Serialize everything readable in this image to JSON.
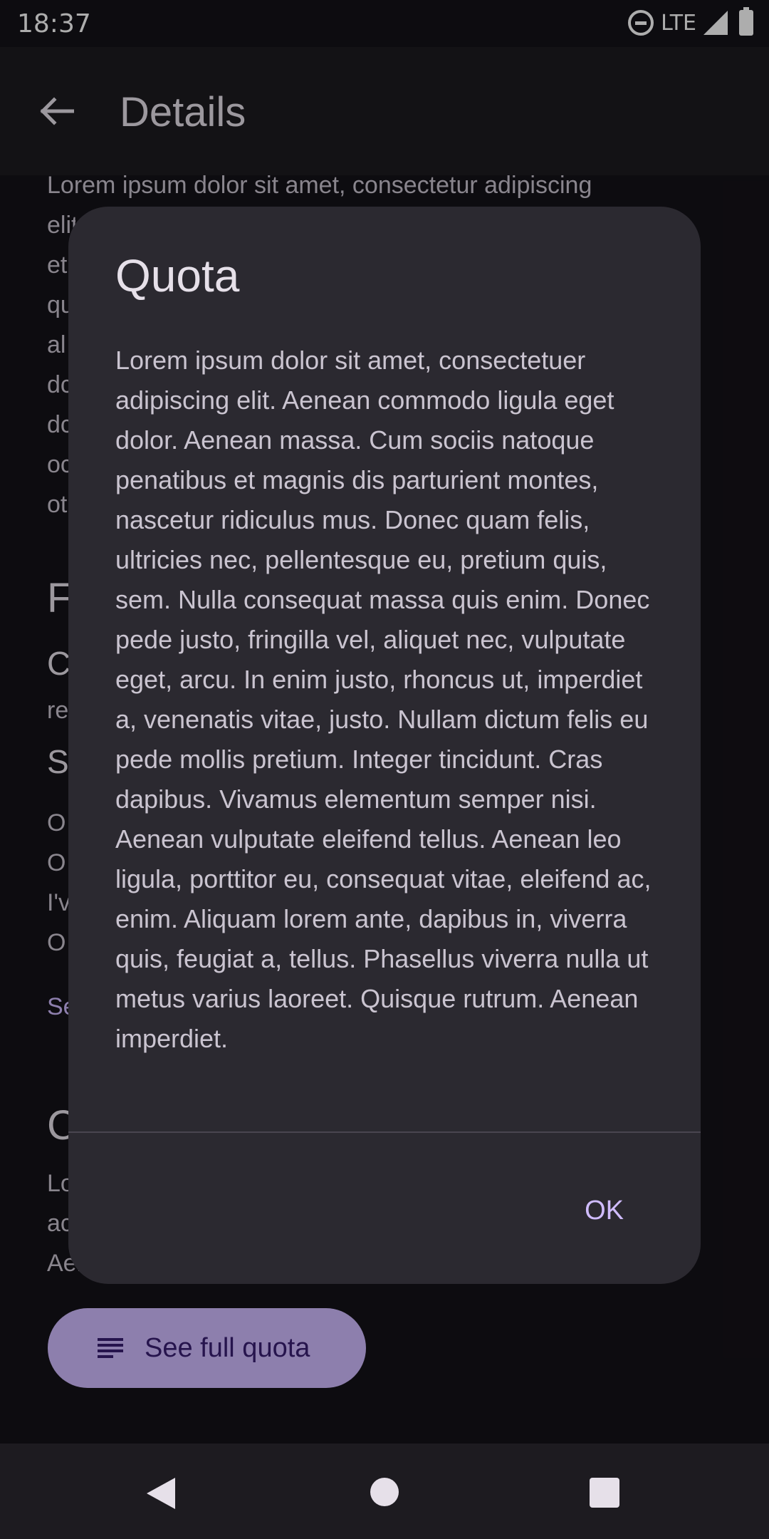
{
  "status_bar": {
    "time": "18:37",
    "network": "LTE"
  },
  "app_bar": {
    "title": "Details"
  },
  "background": {
    "paragraph": "Lorem ipsum dolor sit amet, consectetur adipiscing elit, et qu al dc dc oc ot",
    "heading_stub": "F",
    "sub_stub": "C",
    "small_stub": "re",
    "sub2_stub": "S",
    "lines": [
      "O",
      "O",
      "I'v",
      "O"
    ],
    "link_stub": "Se",
    "heading2_stub": "C",
    "para2_lines": [
      "Lo",
      "ac",
      "Aen"
    ]
  },
  "fab": {
    "label": "See full quota",
    "icon": "notes-icon"
  },
  "dialog": {
    "title": "Quota",
    "body": "Lorem ipsum dolor sit amet, consectetuer adipiscing elit. Aenean commodo ligula eget dolor. Aenean massa. Cum sociis natoque penatibus et magnis dis parturient montes, nascetur ridiculus mus. Donec quam felis, ultricies nec, pellentesque eu, pretium quis, sem. Nulla consequat massa quis enim. Donec pede justo, fringilla vel, aliquet nec, vulputate eget, arcu. In enim justo, rhoncus ut, imperdiet a, venenatis vitae, justo. Nullam dictum felis eu pede mollis pretium. Integer tincidunt. Cras dapibus. Vivamus elementum semper nisi. Aenean vulputate eleifend tellus. Aenean leo ligula, porttitor eu, consequat vitae, eleifend ac, enim. Aliquam lorem ante, dapibus in, viverra quis, feugiat a, tellus. Phasellus viverra nulla ut metus varius laoreet. Quisque rutrum. Aenean imperdiet.",
    "ok_label": "OK"
  },
  "colors": {
    "primary": "#d0bcff",
    "surface": "#2b2930",
    "background": "#141218"
  }
}
